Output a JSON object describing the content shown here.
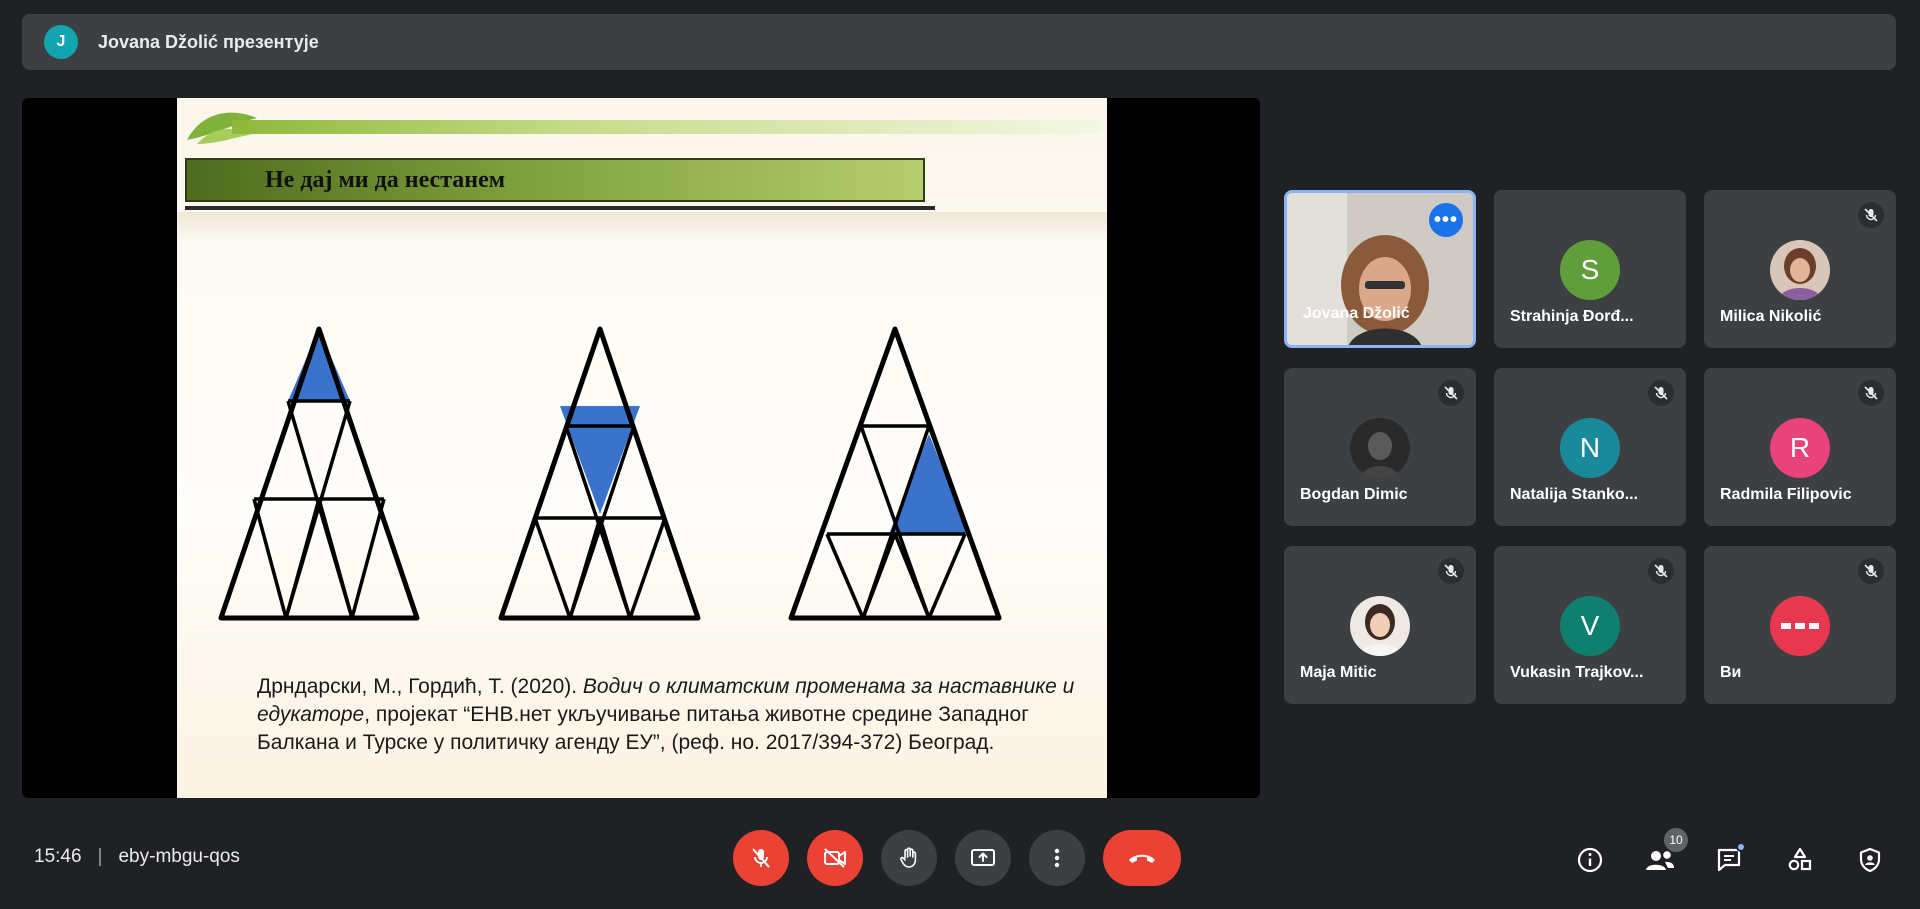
{
  "banner": {
    "avatar_letter": "J",
    "text": "Jovana Džolić презентује",
    "avatar_color": "#12a4af"
  },
  "slide": {
    "title": "Не дај ми да нестанем",
    "citation": {
      "authors": "Дрндарски, М., Гордић, Т. (2020). ",
      "italic": "Водич о климатским променама за наставнике и едукаторе",
      "rest": ", пројекат “ЕНВ.нет укључивање питања животне средине Западног Балкана и Турске у политичку агенду ЕУ”, (реф. но. 2017/394-372) Београд."
    },
    "highlight_color": "#3a72cc"
  },
  "participants": [
    {
      "name": "Jovana Džolić",
      "type": "video",
      "active": true,
      "muted": false
    },
    {
      "name": "Strahinja Đorđ...",
      "letter": "S",
      "color": "#5f9e3a",
      "muted": false
    },
    {
      "name": "Milica Nikolić",
      "type": "photo",
      "muted": true
    },
    {
      "name": "Bogdan Dimic",
      "type": "photo",
      "muted": true
    },
    {
      "name": "Natalija Stanko...",
      "letter": "N",
      "color": "#1a8a9a",
      "muted": true
    },
    {
      "name": "Radmila Filipovic",
      "letter": "R",
      "color": "#e8437a",
      "muted": true
    },
    {
      "name": "Maja Mitic",
      "type": "photo",
      "muted": true
    },
    {
      "name": "Vukasin Trajkov...",
      "letter": "V",
      "color": "#0f7f6f",
      "muted": true
    },
    {
      "name": "Ви",
      "type": "badge",
      "muted": true
    }
  ],
  "bottombar": {
    "time": "15:46",
    "separator": "|",
    "meeting_code": "eby-mbgu-qos",
    "people_count": "10"
  },
  "icons": {
    "mic": "mic-off-icon",
    "camera": "camera-off-icon",
    "hand": "raise-hand-icon",
    "present": "present-screen-icon",
    "more": "more-options-icon",
    "end": "end-call-icon",
    "info": "info-icon",
    "people": "people-icon",
    "chat": "chat-icon",
    "activities": "activities-icon",
    "host": "host-controls-icon"
  }
}
